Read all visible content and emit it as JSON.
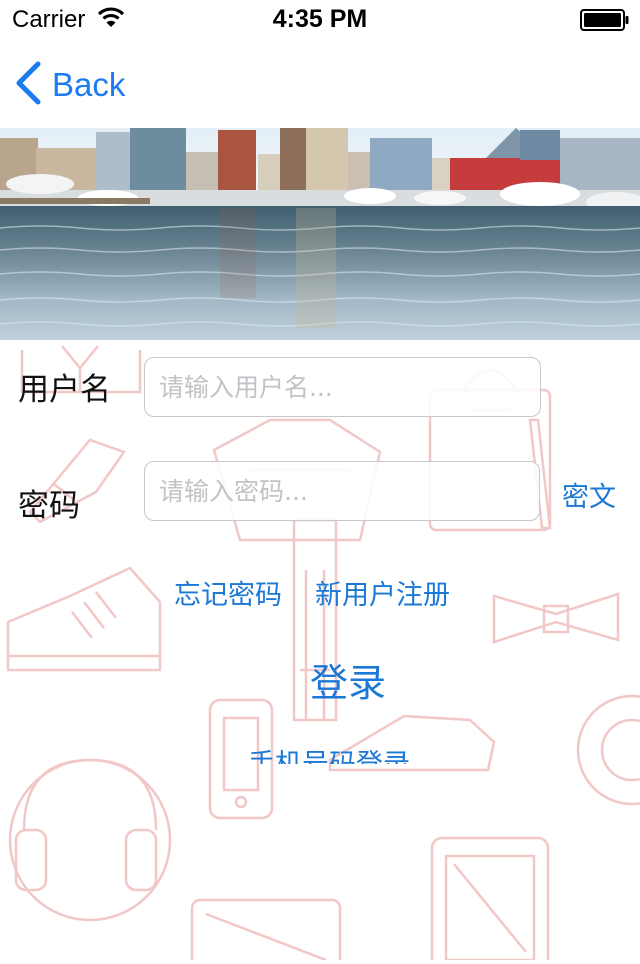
{
  "status_bar": {
    "carrier": "Carrier",
    "time": "4:35 PM"
  },
  "nav": {
    "back_label": "Back"
  },
  "banner": {
    "icon": "harbor-photo"
  },
  "form": {
    "username_label": "用户名",
    "username_placeholder": "请输入用户名...",
    "password_label": "密码",
    "password_placeholder": "请输入密码...",
    "password_toggle": "密文"
  },
  "links": {
    "forgot_password": "忘记密码",
    "register": "新用户注册",
    "login": "登录",
    "phone_login": "手机号码登录"
  },
  "colors": {
    "accent": "#1a7cf0",
    "pattern": "#f2c7c7"
  }
}
